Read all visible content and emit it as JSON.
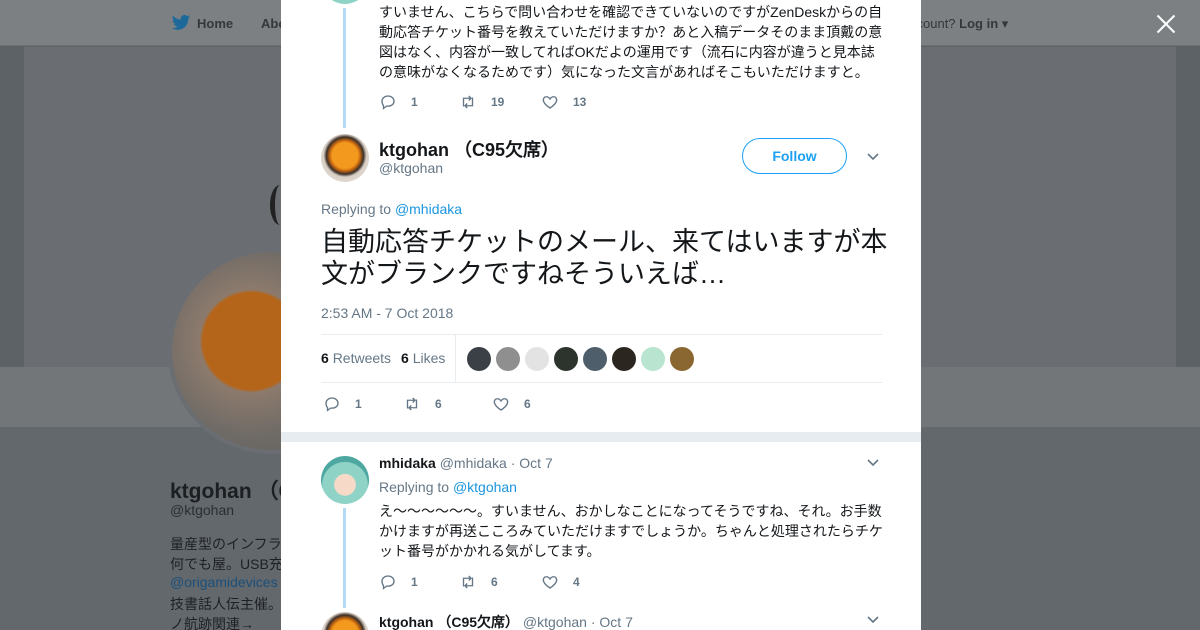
{
  "background": {
    "nav": {
      "home": "Home",
      "about": "Abo",
      "account": "ccount?",
      "login": "Log in"
    },
    "profile_name": "ktgohan （C",
    "profile_handle": "@ktgohan",
    "bio_lines": [
      "量産型のインフラ",
      "何でも屋。USB充",
      "@origamidevices",
      "技書話人伝主催。",
      "ノ航跡関連→"
    ]
  },
  "prev_tweet": {
    "text": "すいません、こちらで問い合わせを確認できていないのですがZenDeskからの自動応答チケット番号を教えていただけますか？あと入稿データそのまま頂戴の意図はなく、内容が一致してればOKだよの運用です（流石に内容が違うと見本誌の意味がなくなるためです）気になった文言があればそこもいただけますと。",
    "replies": "1",
    "retweets": "19",
    "likes": "13"
  },
  "main_tweet": {
    "name": "ktgohan （C95欠席）",
    "handle": "@ktgohan",
    "follow_label": "Follow",
    "replying_prefix": "Replying to",
    "replying_to": "@mhidaka",
    "text": "自動応答チケットのメール、来てはいますが本文がブランクですねそういえば…",
    "timestamp": "2:53 AM - 7 Oct 2018",
    "retweets_count": "6",
    "retweets_label": "Retweets",
    "likes_count": "6",
    "likes_label": "Likes",
    "replies": "1",
    "retweets": "6",
    "likes": "6",
    "liker_colors": [
      "#3b3f46",
      "#8f8f8f",
      "#e3e3e3",
      "#2d332d",
      "#4e5e6a",
      "#2b2620",
      "#b9e4cf",
      "#8a6630"
    ]
  },
  "reply_tweet": {
    "name": "mhidaka",
    "handle": "@mhidaka",
    "date": "· Oct 7",
    "replying_prefix": "Replying to",
    "replying_to": "@ktgohan",
    "text": "え～～～～～～。すいません、おかしなことになってそうですね、それ。お手数かけますが再送こころみていただけますでしょうか。ちゃんと処理されたらチケット番号がかかれる気がしてます。",
    "replies": "1",
    "retweets": "6",
    "likes": "4"
  },
  "next_tweet": {
    "name": "ktgohan （C95欠席）",
    "handle": "@ktgohan",
    "date": "· Oct 7"
  },
  "colors": {
    "accent": "#1da1f2",
    "thread_line": "#b3dbf5",
    "muted": "#657786",
    "text": "#14171a"
  }
}
